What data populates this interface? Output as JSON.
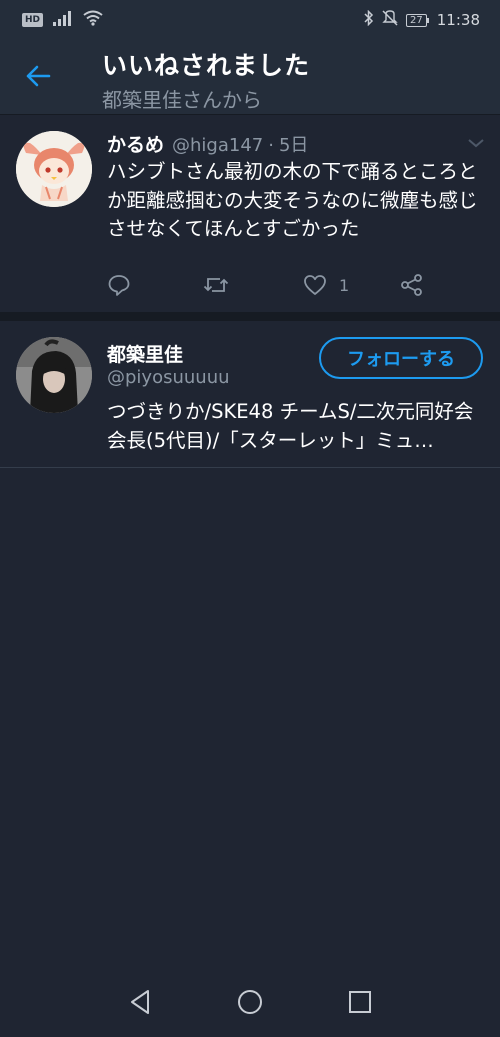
{
  "status_bar": {
    "hd_badge": "HD",
    "battery": "27",
    "time": "11:38"
  },
  "header": {
    "title": "いいねされました",
    "subtitle": "都築里佳さんから"
  },
  "tweet": {
    "name": "かるめ",
    "handle": "@higa147",
    "separator": "·",
    "time": "5日",
    "text": "ハシブトさん最初の木の下で踊るところとか距離感掴むの大変そうなのに微塵も感じさせなくてほんとすごかった",
    "like_count": "1"
  },
  "user_card": {
    "name": "都築里佳",
    "handle": "@piyosuuuuu",
    "follow_label": "フォローする",
    "bio": "つづきりか/SKE48 チームS/二次元同好会会長(5代目)/「スターレット」ミュ…"
  },
  "colors": {
    "background": "#1f2532",
    "header_bg": "#242d3a",
    "accent": "#1d9bf0",
    "secondary_text": "#8b96a3"
  },
  "icons": {
    "back": "arrow-left-icon",
    "chevron": "chevron-down-icon",
    "reply": "reply-icon",
    "retweet": "retweet-icon",
    "like": "heart-icon",
    "share": "share-icon"
  }
}
